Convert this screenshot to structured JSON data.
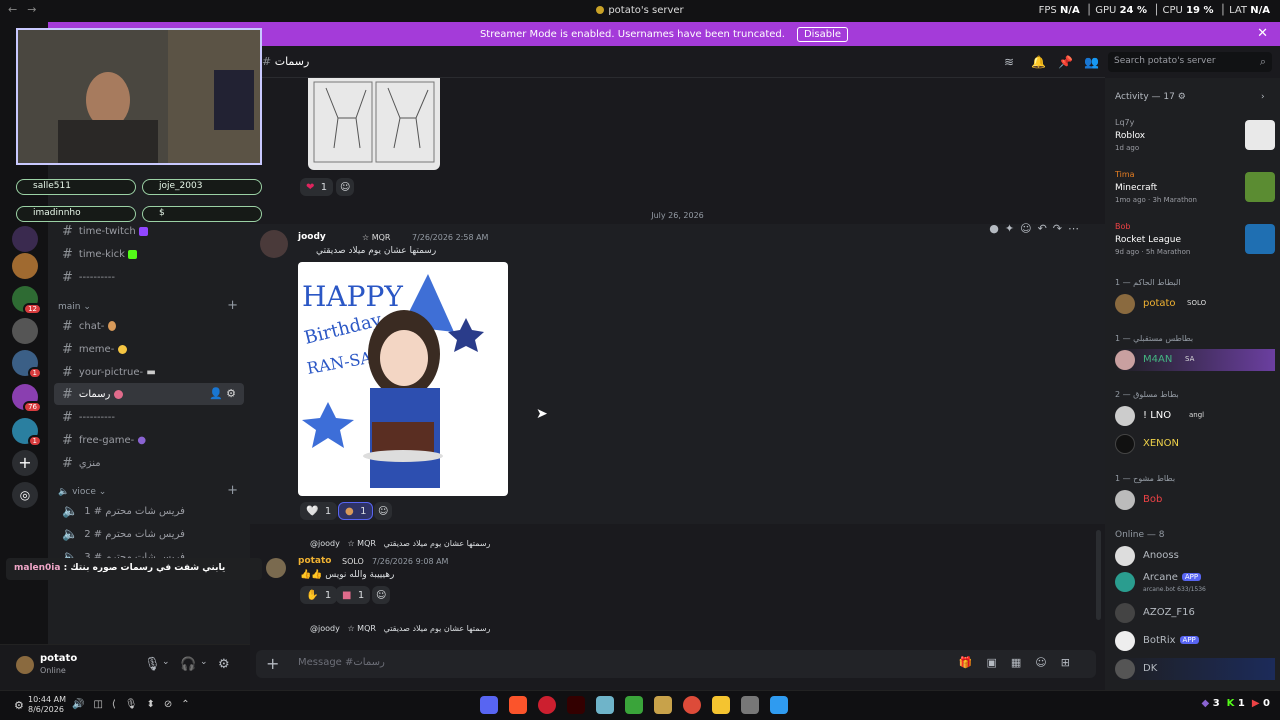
{
  "titlebar": {
    "title": "potato's server",
    "stats": {
      "fps_label": "FPS",
      "fps": "N/A",
      "gpu_label": "GPU",
      "gpu": "24 %",
      "cpu_label": "CPU",
      "cpu": "19 %",
      "lat_label": "LAT",
      "lat": "N/A"
    }
  },
  "banner": {
    "text": "Streamer Mode is enabled. Usernames have been truncated.",
    "button": "Disable"
  },
  "overlay": {
    "pills": [
      "salle511",
      "joje_2003",
      "imadinnho",
      "$"
    ],
    "notification_user": "malen0ia",
    "notification_text": "يابني شفت في رسمات صوره بنتك"
  },
  "channels": {
    "items_top": [
      "time-twitch",
      "time-kick",
      "----------"
    ],
    "category_main": "main",
    "items_main": [
      "chat-",
      "meme-",
      "your-pictrue-",
      "رسمات",
      "----------",
      "free-game-",
      "منزي"
    ],
    "category_voice": "vioce",
    "voice_items": [
      "1 # فريس شات محترم",
      "2 # فريس شات محترم",
      "3 # فريس شات محترم"
    ]
  },
  "user": {
    "name": "potato",
    "status": "Online"
  },
  "header": {
    "channel": "رسمات",
    "search_placeholder": "Search potato's server"
  },
  "chat": {
    "top_reaction_count": "1",
    "date_separator": "July 26, 2026",
    "message": {
      "author": "joody",
      "tag": "MQR",
      "time": "7/26/2026 2:58 AM",
      "text": "رسمتها عشان يوم ميلاد صديقتي"
    },
    "drawing": {
      "line1": "HAPPY",
      "line2": "Birthday",
      "line3": "RAN-SAN"
    },
    "reactions": [
      {
        "count": "1"
      },
      {
        "count": "1"
      }
    ],
    "reply1": {
      "ref_author": "@joody",
      "ref_text": "رسمتها عشان يوم ميلاد صديقتي",
      "author": "potato",
      "tag": "SOLO",
      "time": "7/26/2026 9:08 AM",
      "text": "رهيييبة والله نويس",
      "reaction_count_a": "1",
      "reaction_count_b": "1"
    },
    "reply2": {
      "ref_author": "@joody",
      "ref_text": "رسمتها عشان يوم ميلاد صديقتي"
    },
    "composer_placeholder": "Message #رسمات"
  },
  "members": {
    "activity_header": "Activity — 17",
    "activities": [
      {
        "user": "Lq7y",
        "game": "Roblox",
        "meta": "1d ago"
      },
      {
        "user": "Tima",
        "game": "Minecraft",
        "meta": "1mo ago · 3h Marathon"
      },
      {
        "user": "Bob",
        "game": "Rocket League",
        "meta": "9d ago · 5h Marathon"
      }
    ],
    "groups": [
      {
        "title": "البطاط الحاكم — 1",
        "members": [
          {
            "name": "potato",
            "tag": "SOLO",
            "color": "#f0b232"
          }
        ]
      },
      {
        "title": "بطاطس مستقبلي — 1",
        "members": [
          {
            "name": "M4AN",
            "tag": "SA",
            "color": "#43b581"
          }
        ]
      },
      {
        "title": "بطاط مسلوق — 2",
        "members": [
          {
            "name": "! LNO",
            "tag": "angl",
            "color": "#ffffff"
          },
          {
            "name": "XENON",
            "color": "#f0d34a"
          }
        ]
      },
      {
        "title": "بطاط مشوح — 1",
        "members": [
          {
            "name": "Bob",
            "color": "#ed4245"
          }
        ]
      },
      {
        "title": "Online — 8",
        "members": [
          {
            "name": "Anooss",
            "color": "#b5bac1"
          },
          {
            "name": "Arcane",
            "app": "APP",
            "sub": "arcane.bot 633/1536",
            "color": "#b5bac1"
          },
          {
            "name": "AZOZ_F16",
            "color": "#b5bac1"
          },
          {
            "name": "BotRix",
            "app": "APP",
            "color": "#b5bac1"
          },
          {
            "name": "DK",
            "color": "#b5bac1"
          }
        ]
      }
    ]
  },
  "taskbar": {
    "time": "10:44 AM",
    "date": "8/6/2026",
    "tray": {
      "a": "3",
      "b": "1",
      "c": "0"
    }
  }
}
